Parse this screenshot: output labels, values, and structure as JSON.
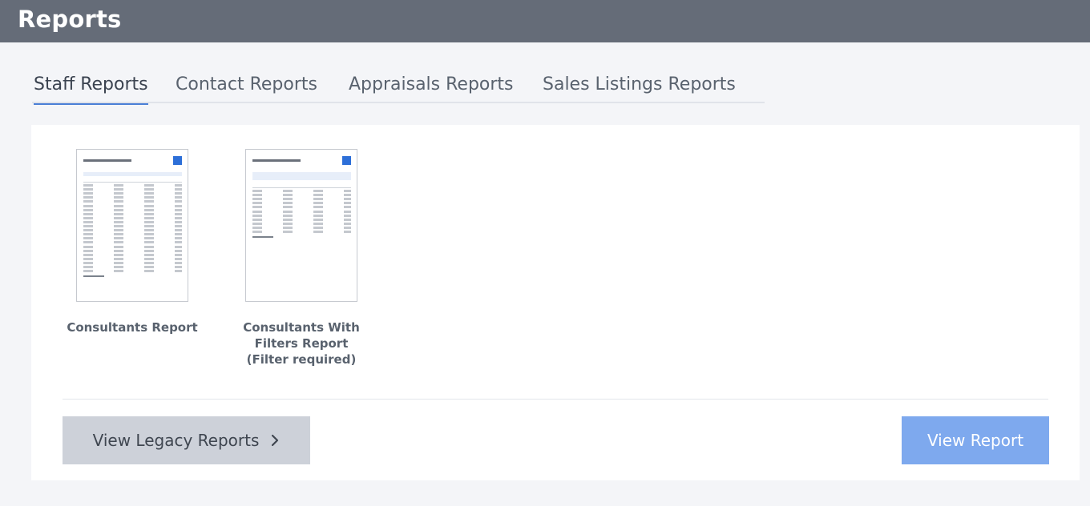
{
  "header": {
    "title": "Reports"
  },
  "tabs": [
    {
      "label": "Staff Reports",
      "active": true
    },
    {
      "label": "Contact Reports",
      "active": false
    },
    {
      "label": "Appraisals Reports",
      "active": false
    },
    {
      "label": "Sales Listings Reports",
      "active": false
    }
  ],
  "reports": [
    {
      "title": "Consultants Report"
    },
    {
      "title_line1": "Consultants With",
      "title_line2": "Filters Report",
      "title_line3": "(Filter required)"
    }
  ],
  "actions": {
    "legacy_label": "View Legacy Reports",
    "view_label": "View Report"
  },
  "colors": {
    "header_bg": "#656c78",
    "accent": "#4a7fd6",
    "primary_button": "#7ea9ee",
    "secondary_button": "#cdd1d9"
  },
  "icons": {
    "legacy_chevron": "chevron-right-icon"
  }
}
